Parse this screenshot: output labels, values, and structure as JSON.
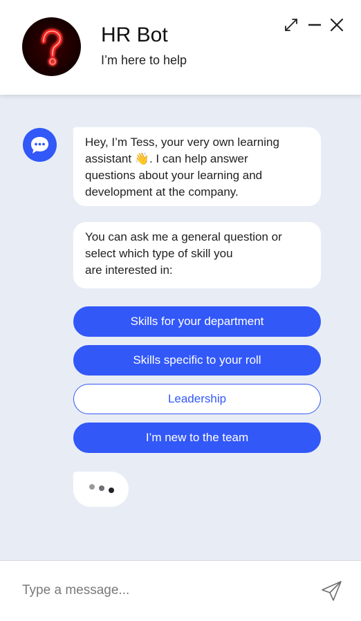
{
  "header": {
    "title": "HR Bot",
    "subtitle": "I’m here to help",
    "avatar_icon": "neon-question-mark-icon",
    "controls": {
      "expand_icon": "expand-arrows-icon",
      "minimize_icon": "minimize-icon",
      "close_icon": "close-icon"
    }
  },
  "conversation": {
    "bot_icon": "chat-bubble-dots-icon",
    "messages": [
      {
        "sender": "bot",
        "text_before_emoji": "Hey, I’m Tess, your very own learning\nassistant ",
        "emoji": "👋",
        "text_after_emoji": ". I can help answer\nquestions about your learning and\ndevelopment at the company."
      },
      {
        "sender": "bot",
        "text": "You can ask me a general question  or\nselect which type of skill you\nare interested in:"
      }
    ],
    "options": [
      {
        "label": "Skills for your department",
        "style": "filled"
      },
      {
        "label": "Skills specific to your roll",
        "style": "filled"
      },
      {
        "label": "Leadership",
        "style": "outline"
      },
      {
        "label": "I’m new to the team",
        "style": "filled"
      }
    ],
    "typing_indicator": true
  },
  "composer": {
    "placeholder": "Type a message...",
    "value": "",
    "send_icon": "send-paper-plane-icon"
  },
  "colors": {
    "accent": "#3258f8",
    "background": "#e8edf5",
    "bubble": "#ffffff"
  }
}
